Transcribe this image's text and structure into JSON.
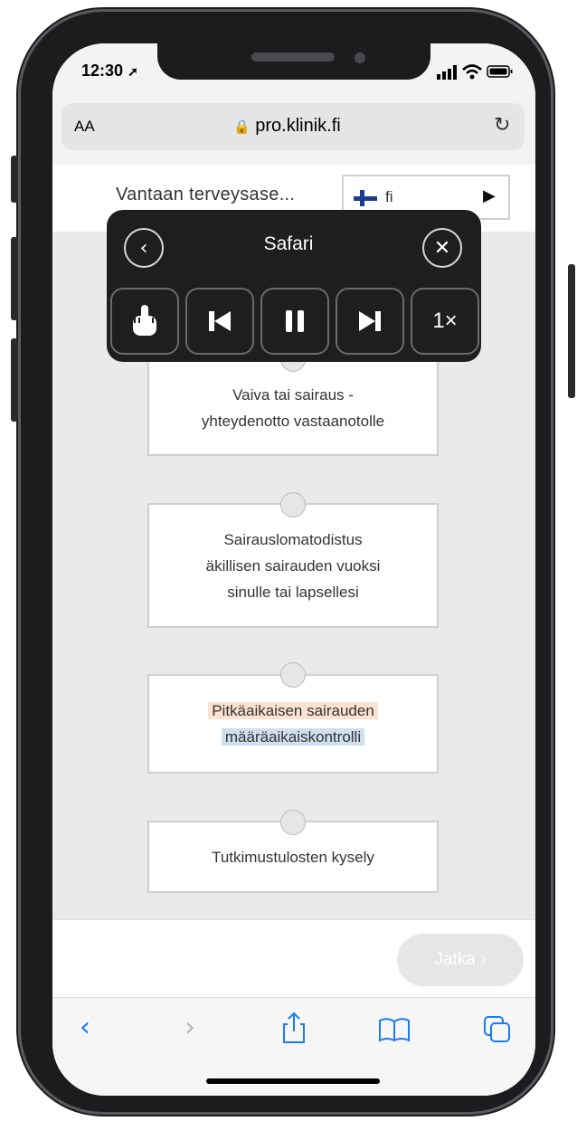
{
  "status": {
    "time": "12:30",
    "location_icon": "location-arrow-icon"
  },
  "browser": {
    "text_size_label": "AA",
    "url": "pro.klinik.fi"
  },
  "header": {
    "clinic_name": "Vantaan terveysase...",
    "language_code": "fi"
  },
  "overlay": {
    "title": "Safari",
    "speed_label": "1×"
  },
  "options": [
    {
      "line1": "Vaiva tai sairaus -",
      "line2": "yhteydenotto vastaanotolle"
    },
    {
      "line1": "Sairauslomatodistus",
      "line2": "äkillisen sairauden vuoksi",
      "line3": "sinulle tai lapsellesi"
    },
    {
      "line1": "Pitkäaikaisen sairauden",
      "line2": "määräaikaiskontrolli"
    },
    {
      "line1": "Tutkimustulosten kysely"
    }
  ],
  "footer": {
    "next_label": "Jatka ›"
  },
  "colors": {
    "ios_blue": "#1a7cf5",
    "highlight_orange": "#fbe3d0",
    "highlight_blue": "#cfdfee",
    "overlay_bg": "#1e1e1f"
  }
}
